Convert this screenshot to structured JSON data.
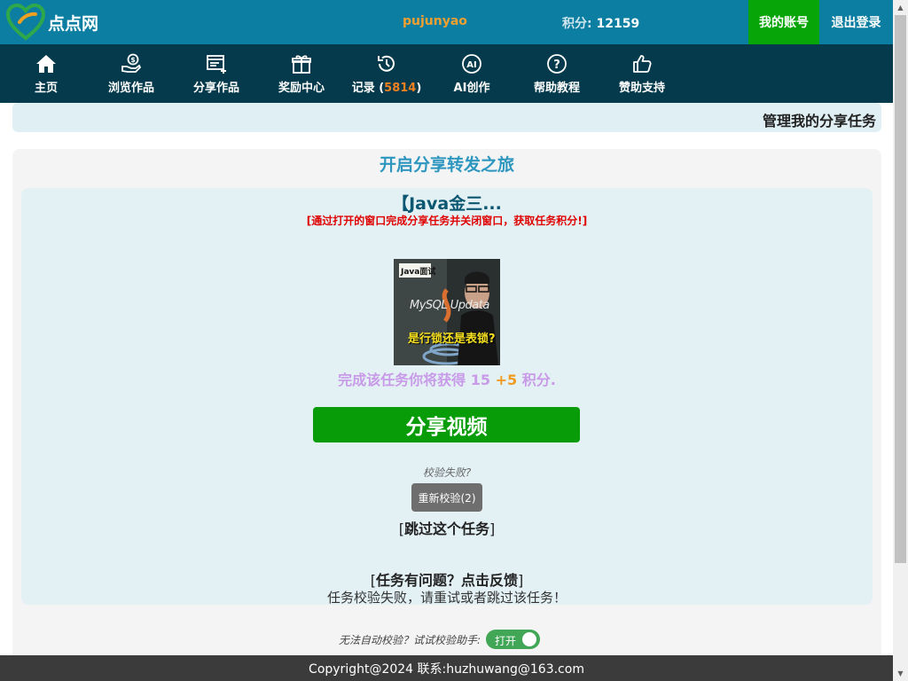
{
  "header": {
    "logo_text": "点点网",
    "username": "pujunyao",
    "points_label": "积分:",
    "points_value": "12159",
    "account_button": "我的账号",
    "logout_button": "退出登录",
    "brand_color": "#0c7ea1"
  },
  "nav": {
    "items": [
      {
        "label": "主页",
        "icon": "home-icon"
      },
      {
        "label": "浏览作品",
        "icon": "coin-hand-icon"
      },
      {
        "label": "分享作品",
        "icon": "share-list-icon"
      },
      {
        "label": "奖励中心",
        "icon": "gift-icon"
      },
      {
        "label": "记录 (",
        "count": "5814",
        "suffix": ")",
        "icon": "history-icon"
      },
      {
        "label": "AI创作",
        "icon": "ai-icon"
      },
      {
        "label": "帮助教程",
        "icon": "help-icon"
      },
      {
        "label": "赞助支持",
        "icon": "thumbs-up-icon"
      }
    ]
  },
  "subbar": {
    "title": "管理我的分享任务"
  },
  "main": {
    "title": "开启分享转发之旅",
    "task": {
      "title": "【Java金三...",
      "note": "[通过打开的窗口完成分享任务并关闭窗口，获取任务积分!]",
      "thumbnail": {
        "badge": "Java面试",
        "line1": "MySQL Updata",
        "line2": "是行锁还是表锁?"
      },
      "reward_prefix": "完成该任务你将获得",
      "reward_points": "15",
      "reward_bonus": "+5",
      "reward_suffix": "积分.",
      "share_button": "分享视频",
      "verify_fail": "校验失败?",
      "recheck_button": "重新校验(2)",
      "skip_open": "[",
      "skip_link": "跳过这个任务",
      "skip_close": "]",
      "feedback_open": "[",
      "feedback_link": "任务有问题？点击反馈",
      "feedback_close": "]",
      "fail_message": "任务校验失败，请重试或者跳过该任务！"
    },
    "helper": {
      "text": "无法自动校验？试试校验助手:",
      "toggle_label": "打开",
      "toggle_on": true
    }
  },
  "footer": {
    "text": "Copyright@2024 联系:huzhuwang@163.com"
  }
}
